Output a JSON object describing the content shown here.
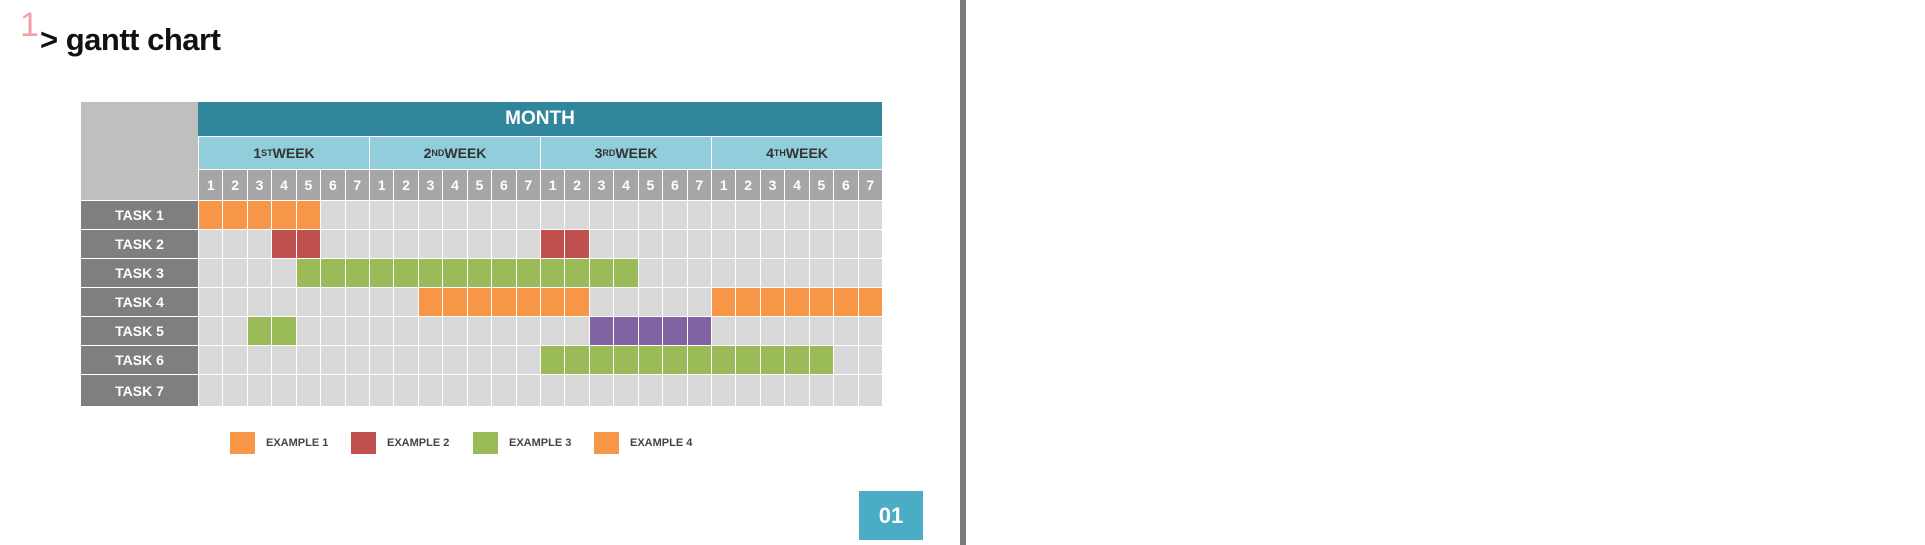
{
  "slide_number": "1",
  "title": "> gantt chart",
  "page_badge": "01",
  "colors": {
    "header": "#31869b",
    "week": "#92cddc",
    "day": "#a6a6a6",
    "task": "#7f7f7f",
    "empty": "#d9d9d9",
    "corner": "#bfbfbf"
  },
  "chart_data": {
    "type": "table",
    "header": "MONTH",
    "weeks": [
      {
        "num": "1",
        "sup": "ST",
        "label": "WEEK"
      },
      {
        "num": "2",
        "sup": "ND",
        "label": "WEEK"
      },
      {
        "num": "3",
        "sup": "RD",
        "label": "WEEK"
      },
      {
        "num": "4",
        "sup": "TH",
        "label": "WEEK"
      }
    ],
    "days": [
      "1",
      "2",
      "3",
      "4",
      "5",
      "6",
      "7"
    ],
    "tasks": [
      {
        "label": "TASK 1",
        "bars": [
          {
            "start": 1,
            "end": 5,
            "color": "#f79646"
          }
        ]
      },
      {
        "label": "TASK 2",
        "bars": [
          {
            "start": 4,
            "end": 5,
            "color": "#c0504d"
          },
          {
            "start": 15,
            "end": 16,
            "color": "#c0504d"
          }
        ]
      },
      {
        "label": "TASK 3",
        "bars": [
          {
            "start": 5,
            "end": 18,
            "color": "#9bbb59"
          }
        ]
      },
      {
        "label": "TASK 4",
        "bars": [
          {
            "start": 10,
            "end": 16,
            "color": "#f79646"
          },
          {
            "start": 22,
            "end": 28,
            "color": "#f79646"
          }
        ]
      },
      {
        "label": "TASK 5",
        "bars": [
          {
            "start": 3,
            "end": 4,
            "color": "#9bbb59"
          },
          {
            "start": 17,
            "end": 21,
            "color": "#8064a2"
          }
        ]
      },
      {
        "label": "TASK 6",
        "bars": [
          {
            "start": 15,
            "end": 26,
            "color": "#9bbb59"
          }
        ]
      },
      {
        "label": "TASK 7",
        "bars": []
      }
    ],
    "legend": [
      {
        "label": "EXAMPLE 1",
        "color": "#f79646"
      },
      {
        "label": "EXAMPLE 2",
        "color": "#c0504d"
      },
      {
        "label": "EXAMPLE 3",
        "color": "#9bbb59"
      },
      {
        "label": "EXAMPLE 4",
        "color": "#f79646"
      }
    ]
  }
}
